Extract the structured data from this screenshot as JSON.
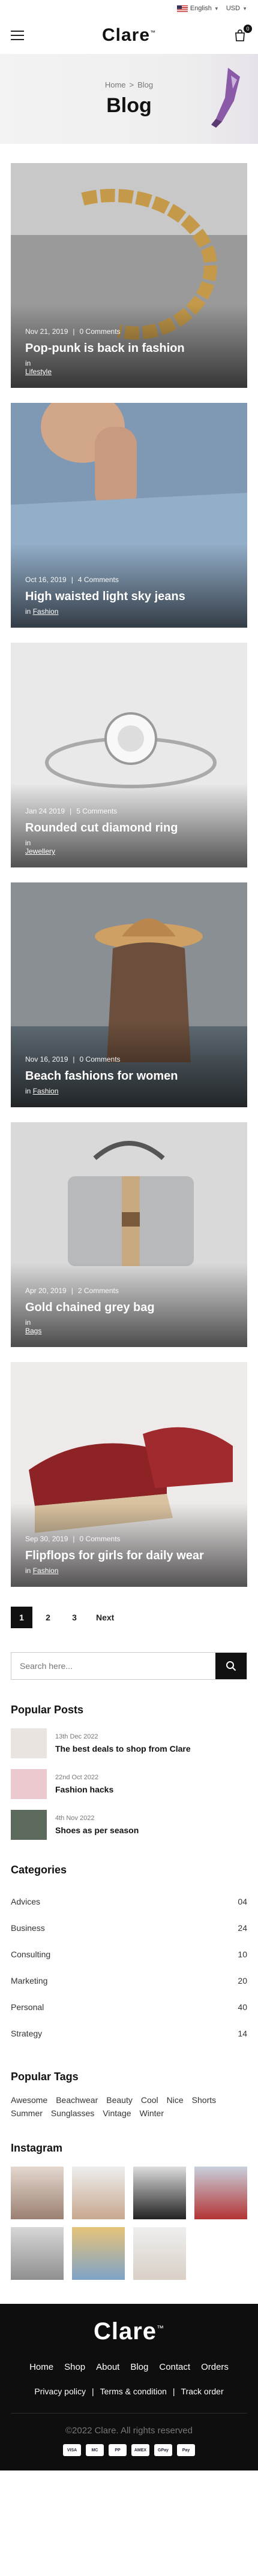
{
  "topbar": {
    "language": "English",
    "currency": "USD"
  },
  "header": {
    "logo": "Clare",
    "logo_mark": "™",
    "cart_count": "0"
  },
  "hero": {
    "crumb_home": "Home",
    "crumb_sep": ">",
    "crumb_current": "Blog",
    "title": "Blog"
  },
  "posts": [
    {
      "date": "Nov 21, 2019",
      "comments": "0 Comments",
      "title": "Pop-punk is back in fashion",
      "in": "in",
      "category": "Lifestyle"
    },
    {
      "date": "Oct 16, 2019",
      "comments": "4 Comments",
      "title": "High waisted light sky jeans",
      "in": "in",
      "category": "Fashion"
    },
    {
      "date": "Jan 24 2019",
      "comments": "5 Comments",
      "title": "Rounded cut diamond ring",
      "in": "in",
      "category": "Jewellery"
    },
    {
      "date": "Nov 16, 2019",
      "comments": "0 Comments",
      "title": "Beach fashions for women",
      "in": "in",
      "category": "Fashion"
    },
    {
      "date": "Apr 20, 2019",
      "comments": "2 Comments",
      "title": "Gold chained grey bag",
      "in": "in",
      "category": "Bags"
    },
    {
      "date": "Sep 30, 2019",
      "comments": "0 Comments",
      "title": "Flipflops for girls for daily wear",
      "in": "in",
      "category": "Fashion"
    }
  ],
  "pagination": {
    "p1": "1",
    "p2": "2",
    "p3": "3",
    "next": "Next"
  },
  "search": {
    "placeholder": "Search here..."
  },
  "popular": {
    "heading": "Popular Posts",
    "items": [
      {
        "date": "13th Dec 2022",
        "title": "The best deals to shop from Clare"
      },
      {
        "date": "22nd Oct 2022",
        "title": "Fashion hacks"
      },
      {
        "date": "4th Nov 2022",
        "title": "Shoes as per season"
      }
    ]
  },
  "categories": {
    "heading": "Categories",
    "items": [
      {
        "name": "Advices",
        "count": "04"
      },
      {
        "name": "Business",
        "count": "24"
      },
      {
        "name": "Consulting",
        "count": "10"
      },
      {
        "name": "Marketing",
        "count": "20"
      },
      {
        "name": "Personal",
        "count": "40"
      },
      {
        "name": "Strategy",
        "count": "14"
      }
    ]
  },
  "tags": {
    "heading": "Popular Tags",
    "items": [
      "Awesome",
      "Beachwear",
      "Beauty",
      "Cool",
      "Nice",
      "Shorts",
      "Summer",
      "Sunglasses",
      "Vintage",
      "Winter"
    ]
  },
  "instagram": {
    "heading": "Instagram"
  },
  "footer": {
    "logo": "Clare",
    "logo_mark": "™",
    "nav": [
      "Home",
      "Shop",
      "About",
      "Blog",
      "Contact",
      "Orders"
    ],
    "links": [
      "Privacy policy",
      "Terms & condition",
      "Track order"
    ],
    "sep": "|",
    "copyright": "©2022 Clare. All rights reserved",
    "payments": [
      "VISA",
      "MC",
      "PP",
      "AMEX",
      "GPay",
      "Pay"
    ]
  },
  "colors": {
    "accent": "#111111",
    "footer_bg": "#0e0e0e"
  }
}
